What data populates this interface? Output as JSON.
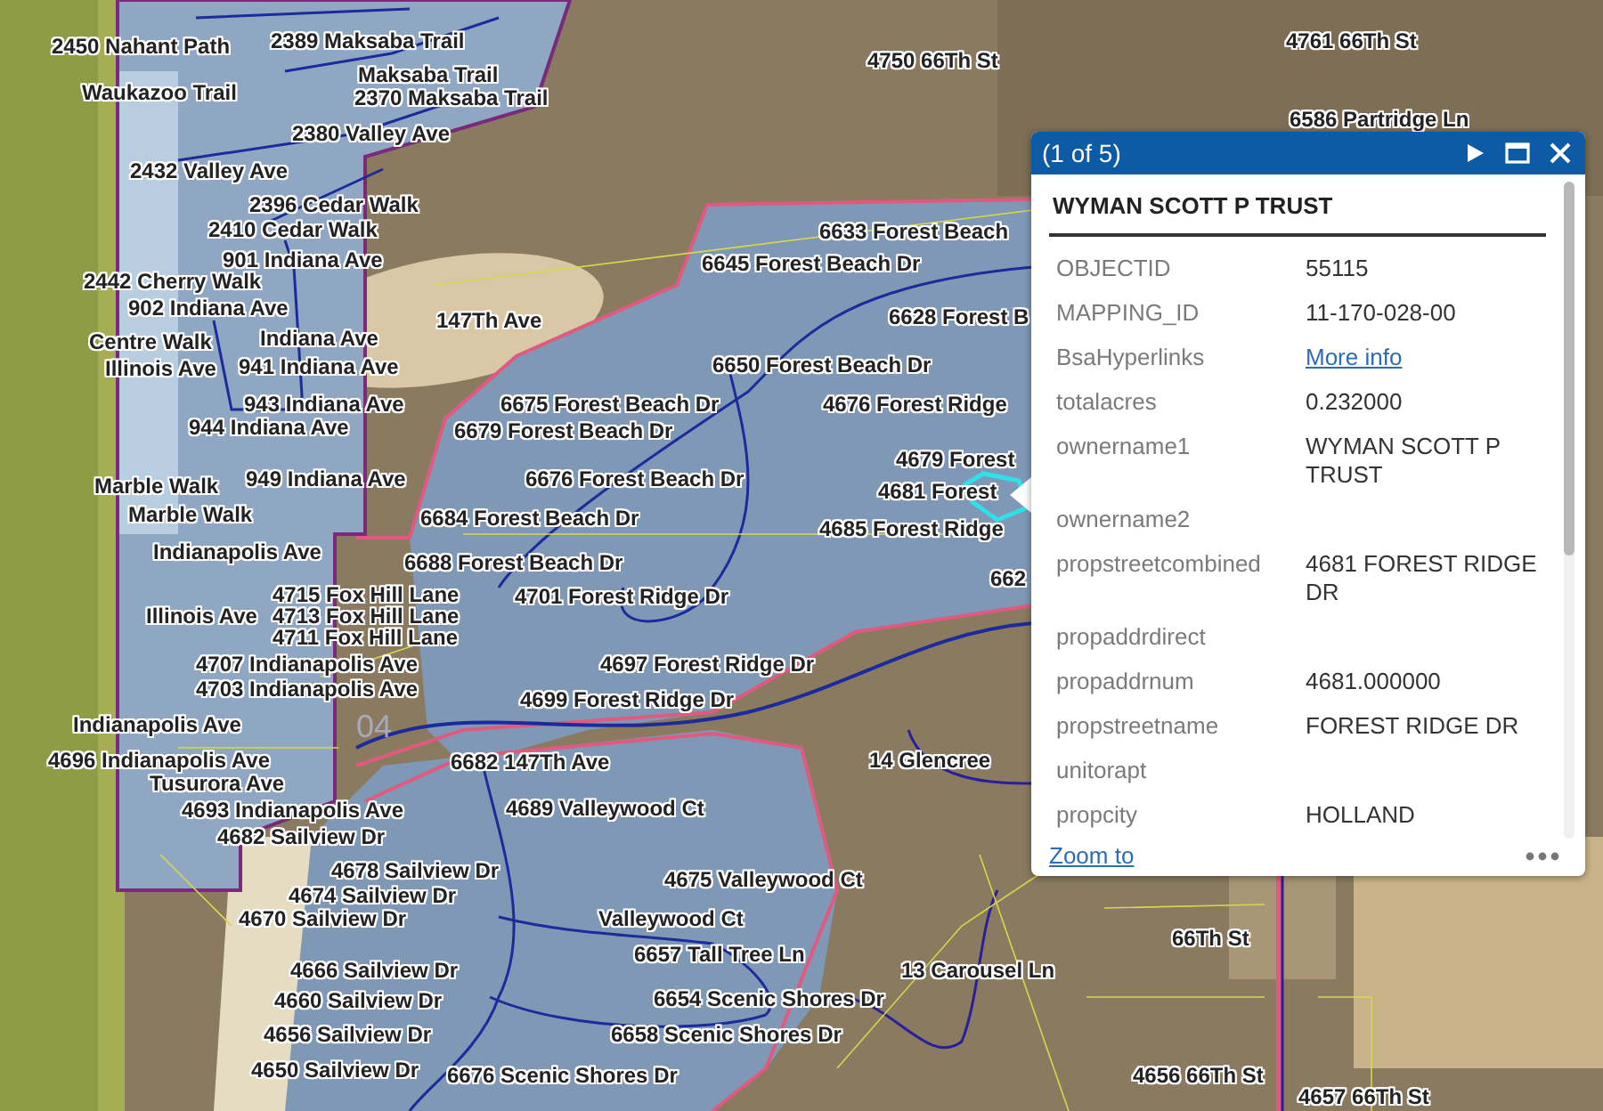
{
  "map": {
    "labels": [
      "2450 Nahant Path",
      "2389 Maksaba Trail",
      "4761 66Th St",
      "4750 66Th St",
      "Maksaba Trail",
      "Waukazoo Trail",
      "2370 Maksaba Trail",
      "6586 Partridge Ln",
      "2380 Valley Ave",
      "2432 Valley Ave",
      "2396 Cedar Walk",
      "2410 Cedar Walk",
      "6633 Forest Beach",
      "901 Indiana Ave",
      "6645 Forest Beach Dr",
      "2442 Cherry Walk",
      "902 Indiana Ave",
      "147Th Ave",
      "6628 Forest B",
      "Centre Walk",
      "Indiana Ave",
      "Illinois Ave",
      "941 Indiana Ave",
      "6650 Forest Beach Dr",
      "943 Indiana Ave",
      "6675 Forest Beach Dr",
      "4676 Forest Ridge",
      "944 Indiana Ave",
      "6679 Forest Beach Dr",
      "4679 Forest",
      "Marble Walk",
      "949 Indiana Ave",
      "6676 Forest Beach Dr",
      "4681 Forest",
      "Marble Walk",
      "6684 Forest Beach Dr",
      "4685 Forest Ridge",
      "Indianapolis Ave",
      "6688 Forest Beach Dr",
      "662",
      "4715 Fox Hill Lane",
      "4701 Forest Ridge Dr",
      "Illinois Ave",
      "4713 Fox Hill Lane",
      "4711 Fox Hill Lane",
      "4707 Indianapolis Ave",
      "4697 Forest Ridge Dr",
      "4703 Indianapolis Ave",
      "4699 Forest Ridge Dr",
      "Indianapolis Ave",
      "4696 Indianapolis Ave",
      "6682 147Th Ave",
      "14 Glencree",
      "Tusurora Ave",
      "4693 Indianapolis Ave",
      "4689 Valleywood Ct",
      "4682 Sailview Dr",
      "4678 Sailview Dr",
      "4675 Valleywood Ct",
      "4674 Sailview Dr",
      "4670 Sailview Dr",
      "Valleywood Ct",
      "66Th St",
      "6657 Tall Tree Ln",
      "4666 Sailview Dr",
      "13 Carousel Ln",
      "4660 Sailview Dr",
      "6654 Scenic Shores Dr",
      "4656 Sailview Dr",
      "6658 Scenic Shores Dr",
      "4650 Sailview Dr",
      "6676 Scenic Shores Dr",
      "4656 66Th St",
      "4657 66Th St"
    ],
    "section_number": "04"
  },
  "popup": {
    "header": "(1 of 5)",
    "title": "WYMAN SCOTT P TRUST",
    "fields": [
      {
        "name": "OBJECTID",
        "value": "55115",
        "kind": "text"
      },
      {
        "name": "MAPPING_ID",
        "value": "11-170-028-00",
        "kind": "text"
      },
      {
        "name": "BsaHyperlinks",
        "value": "More info",
        "kind": "link"
      },
      {
        "name": "totalacres",
        "value": "0.232000",
        "kind": "text"
      },
      {
        "name": "ownername1",
        "value": "WYMAN SCOTT P TRUST",
        "kind": "text"
      },
      {
        "name": "ownername2",
        "kind": "text"
      },
      {
        "name": "propstreetcombined",
        "value": "4681 FOREST RIDGE DR",
        "kind": "text"
      },
      {
        "name": "propaddrdirect",
        "kind": "text"
      },
      {
        "name": "propaddrnum",
        "value": "4681.000000",
        "kind": "text"
      },
      {
        "name": "propstreetname",
        "value": "FOREST RIDGE DR",
        "kind": "text"
      },
      {
        "name": "unitorapt",
        "kind": "text"
      },
      {
        "name": "propcity",
        "value": "HOLLAND",
        "kind": "text"
      }
    ],
    "footer_link": "Zoom to"
  }
}
